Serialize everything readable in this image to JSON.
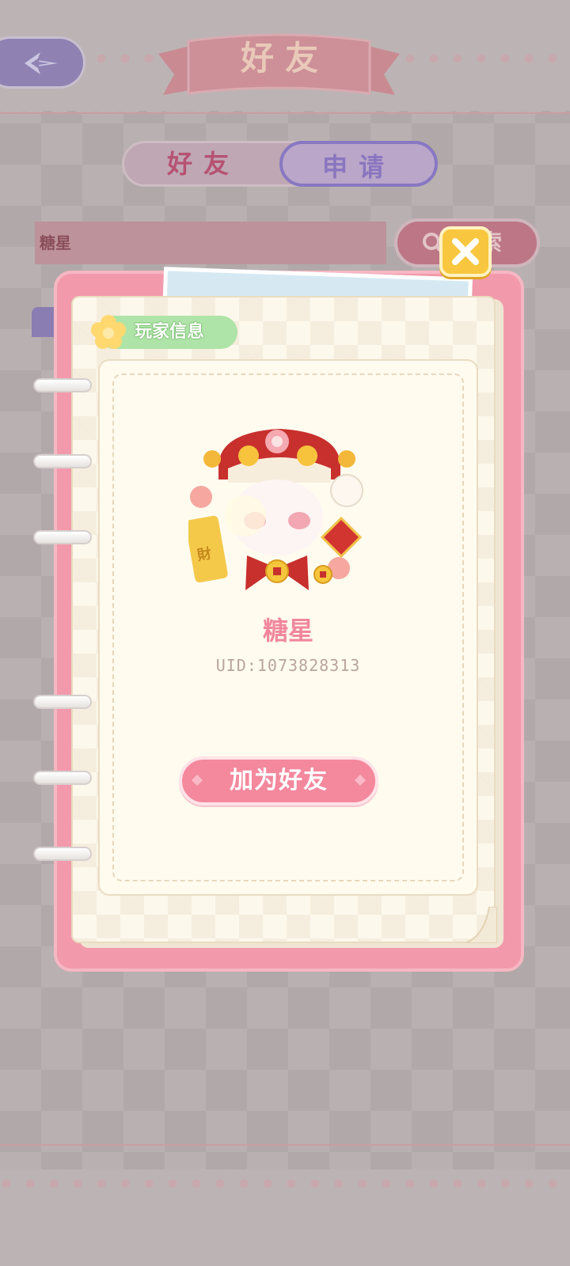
{
  "header": {
    "title": "好友",
    "back_icon": "back-arrow-icon"
  },
  "tabs": [
    {
      "label": "好友",
      "selected": false
    },
    {
      "label": "申请",
      "selected": true
    }
  ],
  "search": {
    "value": "糖星",
    "button_label": "搜索",
    "button_visible_label": "索",
    "icon": "magnifier-icon"
  },
  "dialog": {
    "section_label": "玩家信息",
    "section_icon": "flower-icon",
    "player": {
      "name": "糖星",
      "uid": "UID:1073828313",
      "avatar": "lion-dance-panda-avatar"
    },
    "add_friend_label": "加为好友",
    "close_icon": "close-icon"
  },
  "colors": {
    "dialog_frame": "#f29aab",
    "page": "#fdf8ec",
    "name": "#f0879d",
    "button": "#f4889d",
    "close": "#f8c73f",
    "tag": "#aee4a7"
  }
}
